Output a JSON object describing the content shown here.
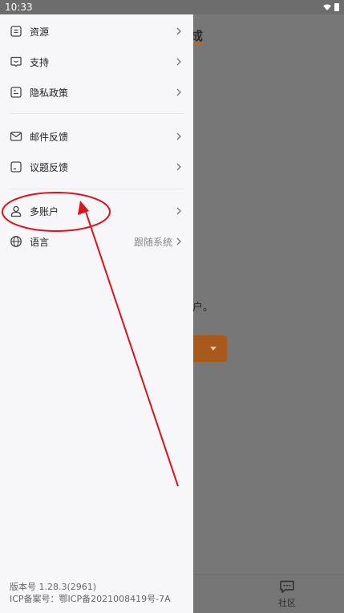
{
  "status": {
    "time": "10:33"
  },
  "background": {
    "title_fragment": "成",
    "text_fragment": "户。",
    "nav_community": "社区"
  },
  "menu": {
    "items": [
      {
        "label": "资源",
        "icon": "document-icon"
      },
      {
        "label": "支持",
        "icon": "support-chat-icon"
      },
      {
        "label": "隐私政策",
        "icon": "policy-document-icon"
      },
      {
        "label": "邮件反馈",
        "icon": "mail-icon"
      },
      {
        "label": "议题反馈",
        "icon": "feedback-icon"
      },
      {
        "label": "多账户",
        "icon": "user-icon"
      },
      {
        "label": "语言",
        "icon": "globe-icon",
        "value": "跟随系统"
      }
    ]
  },
  "footer": {
    "version": "版本号 1.28.3(2961)",
    "icp": "ICP备案号：鄂ICP备2021008419号-7A"
  },
  "colors": {
    "accent": "#c86414",
    "annotation": "#d9141e",
    "drawer_bg": "#f7f7f9"
  }
}
